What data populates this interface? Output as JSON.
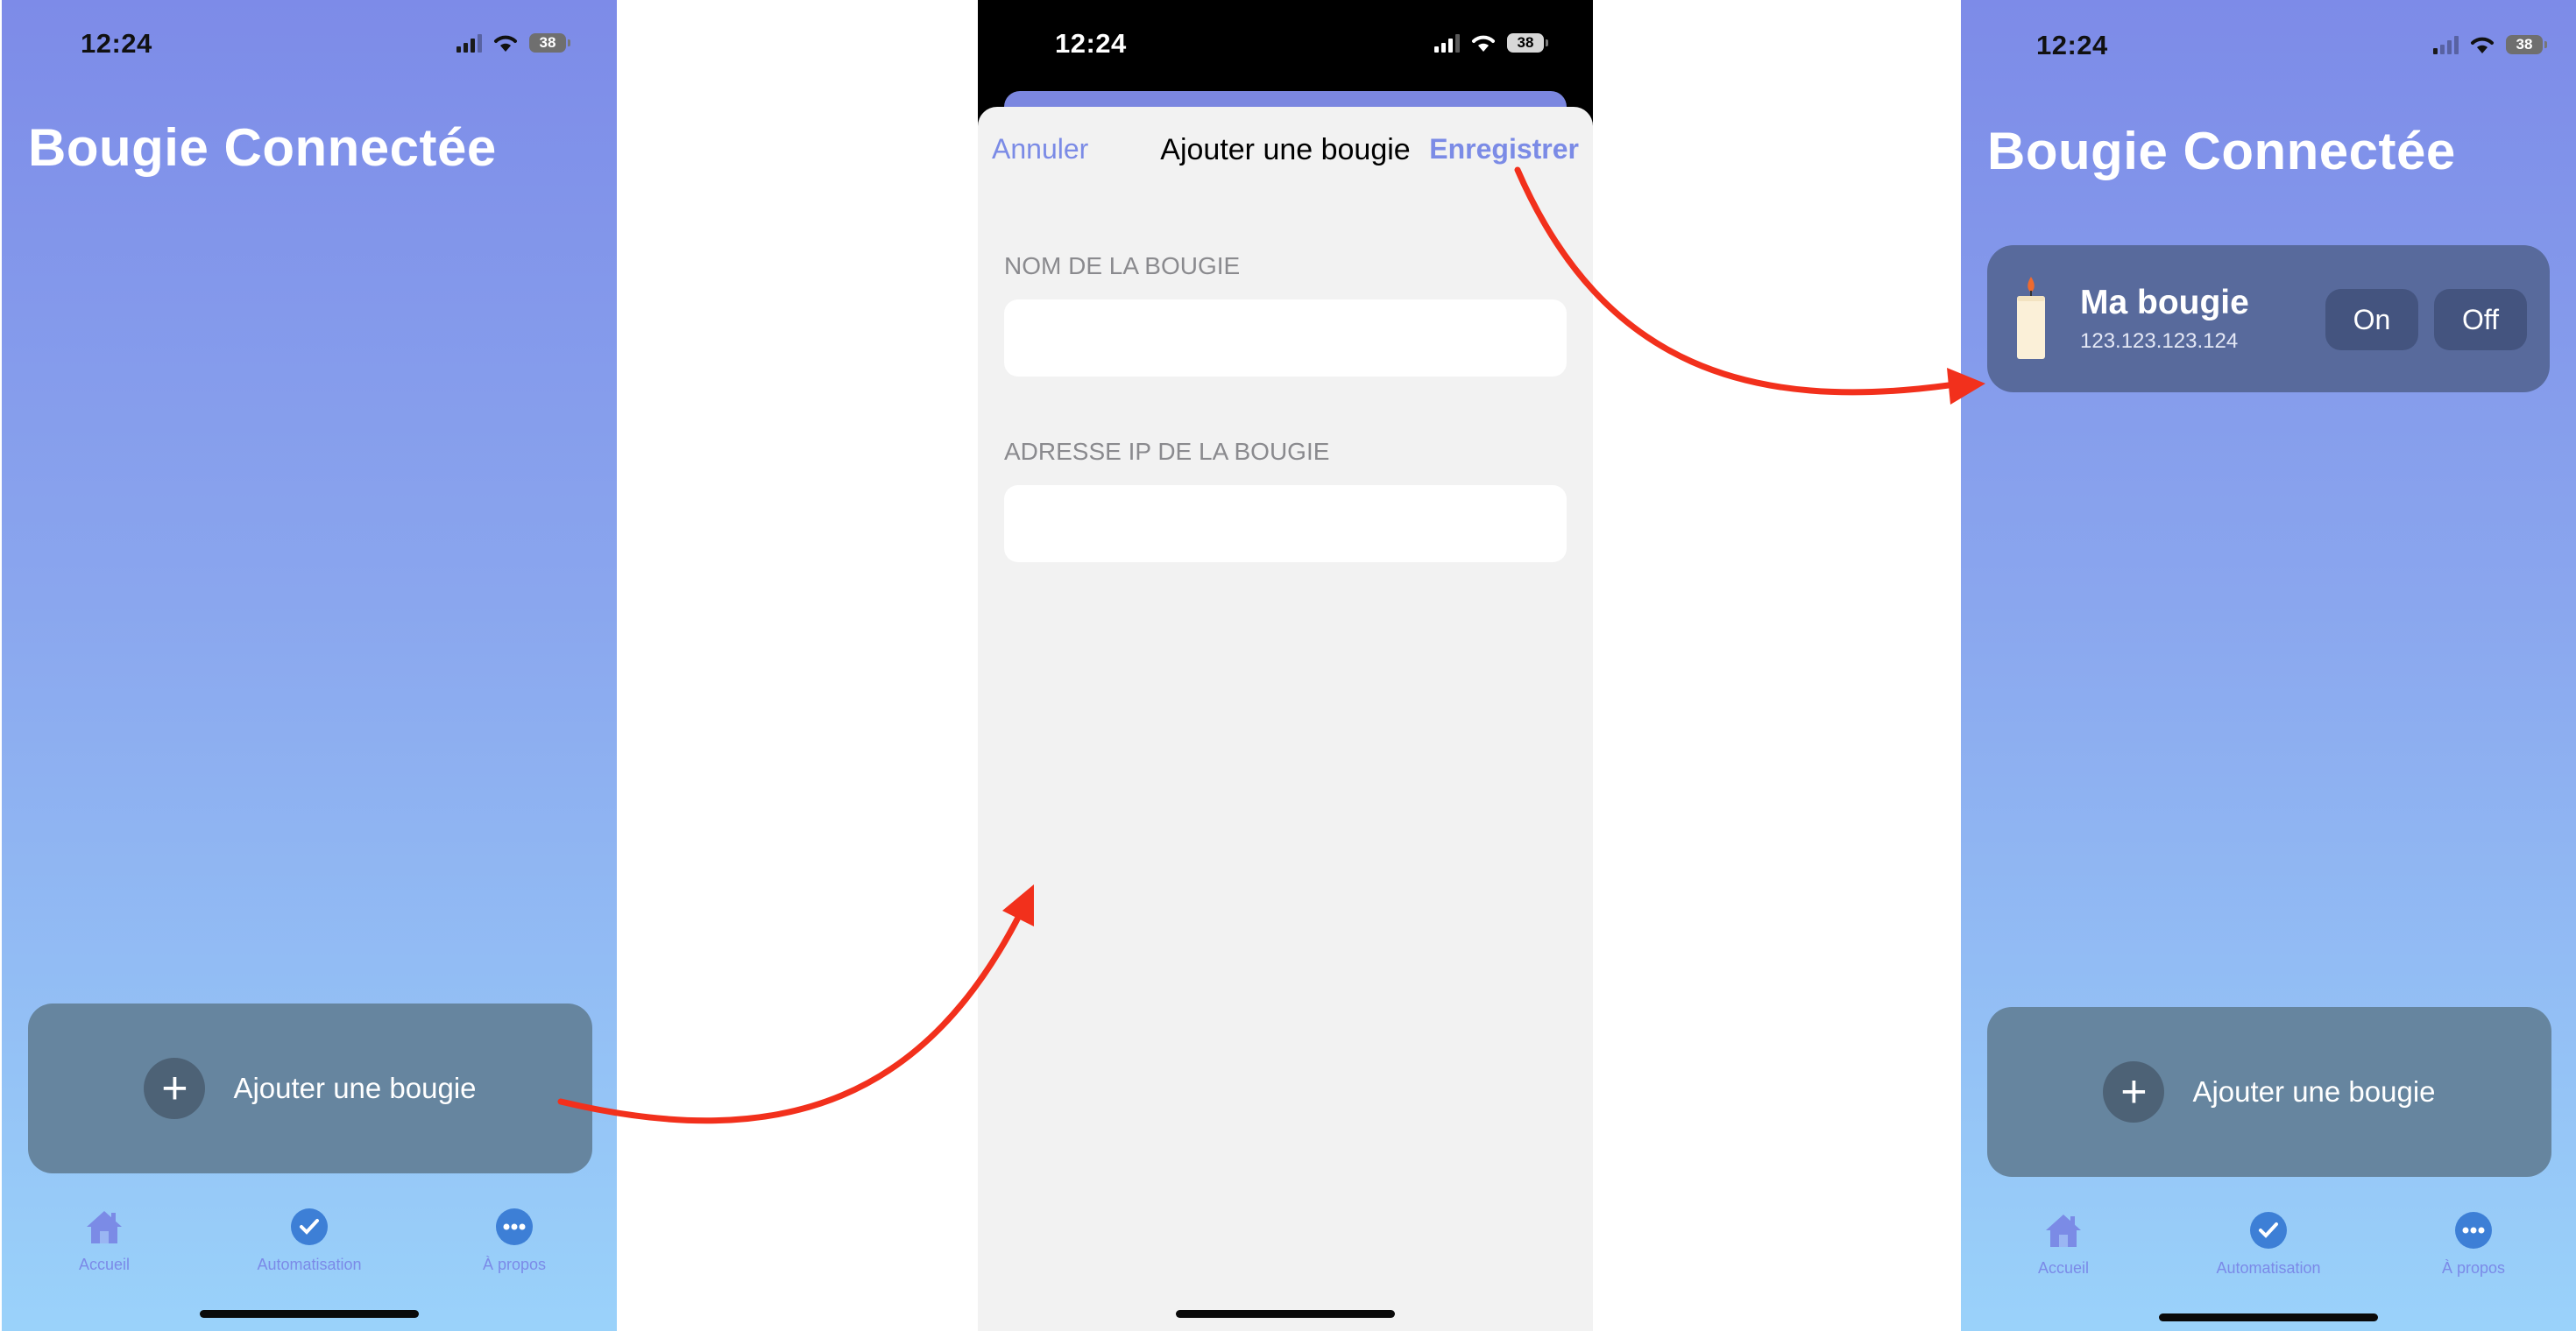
{
  "status": {
    "time": "12:24",
    "battery": "38"
  },
  "app": {
    "title": "Bougie Connectée"
  },
  "add_button": {
    "label": "Ajouter une bougie"
  },
  "tabs": [
    {
      "label": "Accueil",
      "icon": "house-icon"
    },
    {
      "label": "Automatisation",
      "icon": "clock-icon"
    },
    {
      "label": "À propos",
      "icon": "ellipsis-icon"
    }
  ],
  "form": {
    "cancel": "Annuler",
    "title": "Ajouter une bougie",
    "save": "Enregistrer",
    "name_label": "NOM DE LA BOUGIE",
    "name_value": "",
    "ip_label": "ADRESSE IP DE LA BOUGIE",
    "ip_value": ""
  },
  "candle": {
    "name": "Ma bougie",
    "ip": "123.123.123.124",
    "on_label": "On",
    "off_label": "Off",
    "icon": "candle-icon"
  },
  "colors": {
    "accent": "#7b8be6",
    "arrow": "#f2301c",
    "card": "#586a9c",
    "add_button": "#66859f"
  }
}
